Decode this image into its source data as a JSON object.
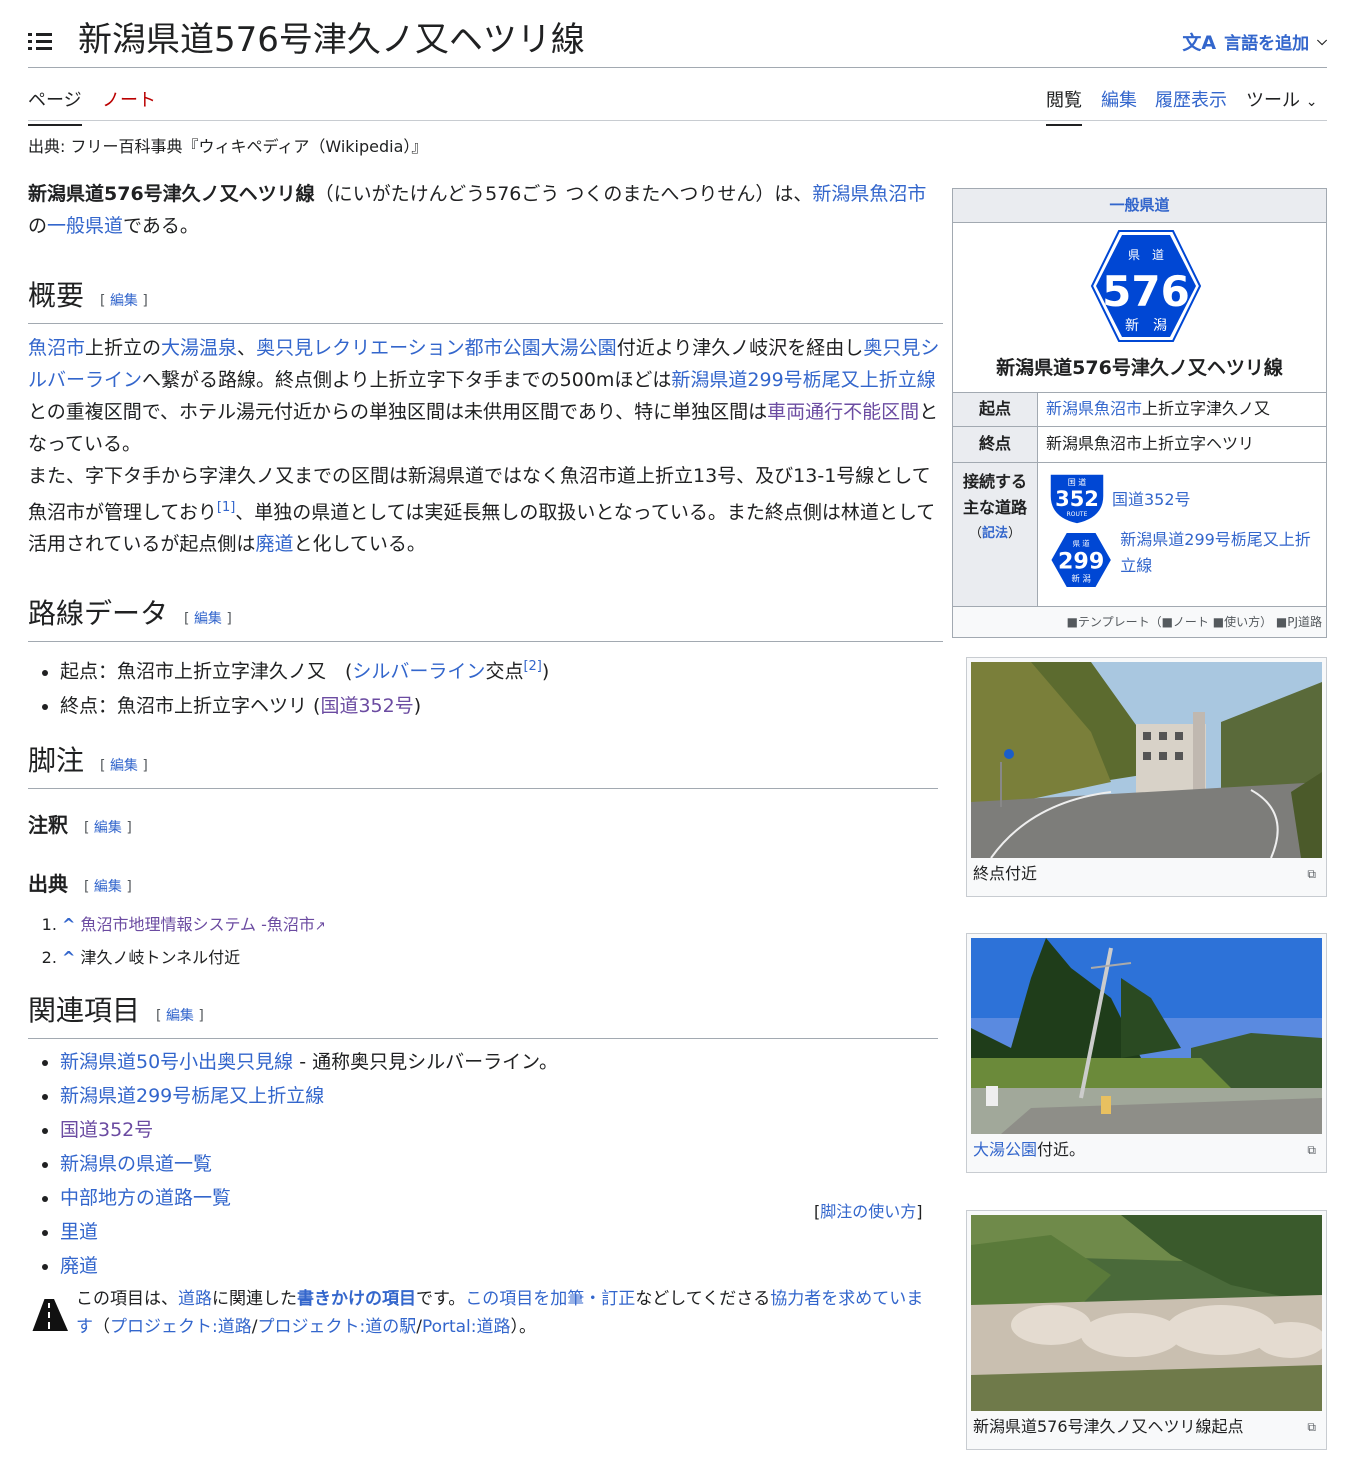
{
  "header": {
    "title": "新潟県道576号津久ノ又ヘツリ線",
    "lang_label": "言語を追加",
    "lang_icon": "文A"
  },
  "tabs": {
    "page": "ページ",
    "talk": "ノート",
    "read": "閲覧",
    "edit": "編集",
    "history": "履歴表示",
    "tools": "ツール"
  },
  "site_sub": "出典: フリー百科事典『ウィキペディア（Wikipedia）』",
  "lead": {
    "bold": "新潟県道576号津久ノ又ヘツリ線",
    "reading": "（にいがたけんどう576ごう つくのまたへつりせん）は、",
    "link1": "新潟県魚沼市",
    "text1": "の",
    "link2": "一般県道",
    "text2": "である。"
  },
  "edit_label": "編集",
  "sections": {
    "overview": "概要",
    "route_data": "路線データ",
    "footnotes": "脚注",
    "notes": "注釈",
    "sources": "出典",
    "related": "関連項目"
  },
  "overview": {
    "p1": [
      {
        "t": "魚沼市",
        "l": true
      },
      {
        "t": "上折立の",
        "l": false
      },
      {
        "t": "大湯温泉",
        "l": true
      },
      {
        "t": "、",
        "l": false
      },
      {
        "t": "奥只見レクリエーション都市公園大湯公園",
        "l": true
      },
      {
        "t": "付近より津久ノ岐沢を経由し",
        "l": false
      },
      {
        "t": "奥只見シルバーライン",
        "l": true
      },
      {
        "t": "へ繋がる路線。終点側より上折立字下タ手までの500mほどは",
        "l": false
      },
      {
        "t": "新潟県道299号栃尾又上折立線",
        "l": true
      },
      {
        "t": "との重複区間で、ホテル湯元付近からの単独区間は未供用区間であり、特に単独区間は",
        "l": false
      },
      {
        "t": "車両通行不能区間",
        "l": true
      },
      {
        "t": "となっている。",
        "l": false
      }
    ],
    "p2a": "また、字下タ手から字津久ノ又までの区間は新潟県道ではなく魚沼市道上折立13号、及び13-1号線として魚沼市が管理しており",
    "p2_ref": "[1]",
    "p2b": "、単独の県道としては実延長無しの取扱いとなっている。また終点側は林道として活用されているが起点側は",
    "p2_link": "廃道",
    "p2c": "と化している。"
  },
  "route": {
    "start_prefix": "起点：魚沼市上折立字津久ノ又　(",
    "start_link": "シルバーライン",
    "start_suffix": "交点",
    "start_ref": "[2]",
    "start_close": ")",
    "end_prefix": "終点：魚沼市上折立字ヘツリ (",
    "end_link": "国道352号",
    "end_close": ")"
  },
  "refs": [
    {
      "caret": "^",
      "text": "魚沼市地理情報システム -魚沼市",
      "link": true
    },
    {
      "caret": "^",
      "text": "津久ノ岐トンネル付近",
      "link": false
    }
  ],
  "related": {
    "item1_link": "新潟県道50号小出奥只見線",
    "item1_text": " - 通称奥只見シルバーライン。",
    "items": [
      "新潟県道299号栃尾又上折立線",
      "国道352号",
      "新潟県の県道一覧",
      "中部地方の道路一覧",
      "里道",
      "廃道"
    ]
  },
  "ref_usage": {
    "open": "[",
    "link": "脚注の使い方",
    "close": "]"
  },
  "stub": {
    "t1": "この項目は、",
    "l1": "道路",
    "t2": "に関連した",
    "l2": "書きかけの項目",
    "t3": "です。",
    "l3": "この項目を加筆・訂正",
    "t4": "などしてくださる",
    "l4": "協力者を求めています",
    "t5": "（",
    "l5": "プロジェクト:道路",
    "t6": "/",
    "l6": "プロジェクト:道の駅",
    "t7": "/",
    "l7": "Portal:道路",
    "t8": "）。"
  },
  "infobox": {
    "header": "一般県道",
    "sign": {
      "top": "県　道",
      "number": "576",
      "bottom": "新　潟",
      "color": "#0047d4"
    },
    "title": "新潟県道576号津久ノ又ヘツリ線",
    "start_label": "起点",
    "start_link": "新潟県魚沼市",
    "start_text": "上折立字津久ノ又",
    "end_label": "終点",
    "end_text": "新潟県魚沼市上折立字ヘツリ",
    "conn_label1": "接続する",
    "conn_label2": "主な道路",
    "conn_note": "（記法）",
    "conn_note_link": "記法",
    "conn1": {
      "badge_top": "国 道",
      "badge_num": "352",
      "badge_bottom": "ROUTE",
      "link": "国道352号"
    },
    "conn2": {
      "badge_top": "県 道",
      "badge_num": "299",
      "badge_bottom": "新 潟",
      "link": "新潟県道299号栃尾又上折立線"
    },
    "footer": "■テンプレート（■ノート ■使い方）  ■PJ道路"
  },
  "thumbs": [
    {
      "caption": "終点付近",
      "link": ""
    },
    {
      "caption_link": "大湯公園",
      "caption": "付近。"
    },
    {
      "caption": "新潟県道576号津久ノ又ヘツリ線起点",
      "link": ""
    }
  ]
}
